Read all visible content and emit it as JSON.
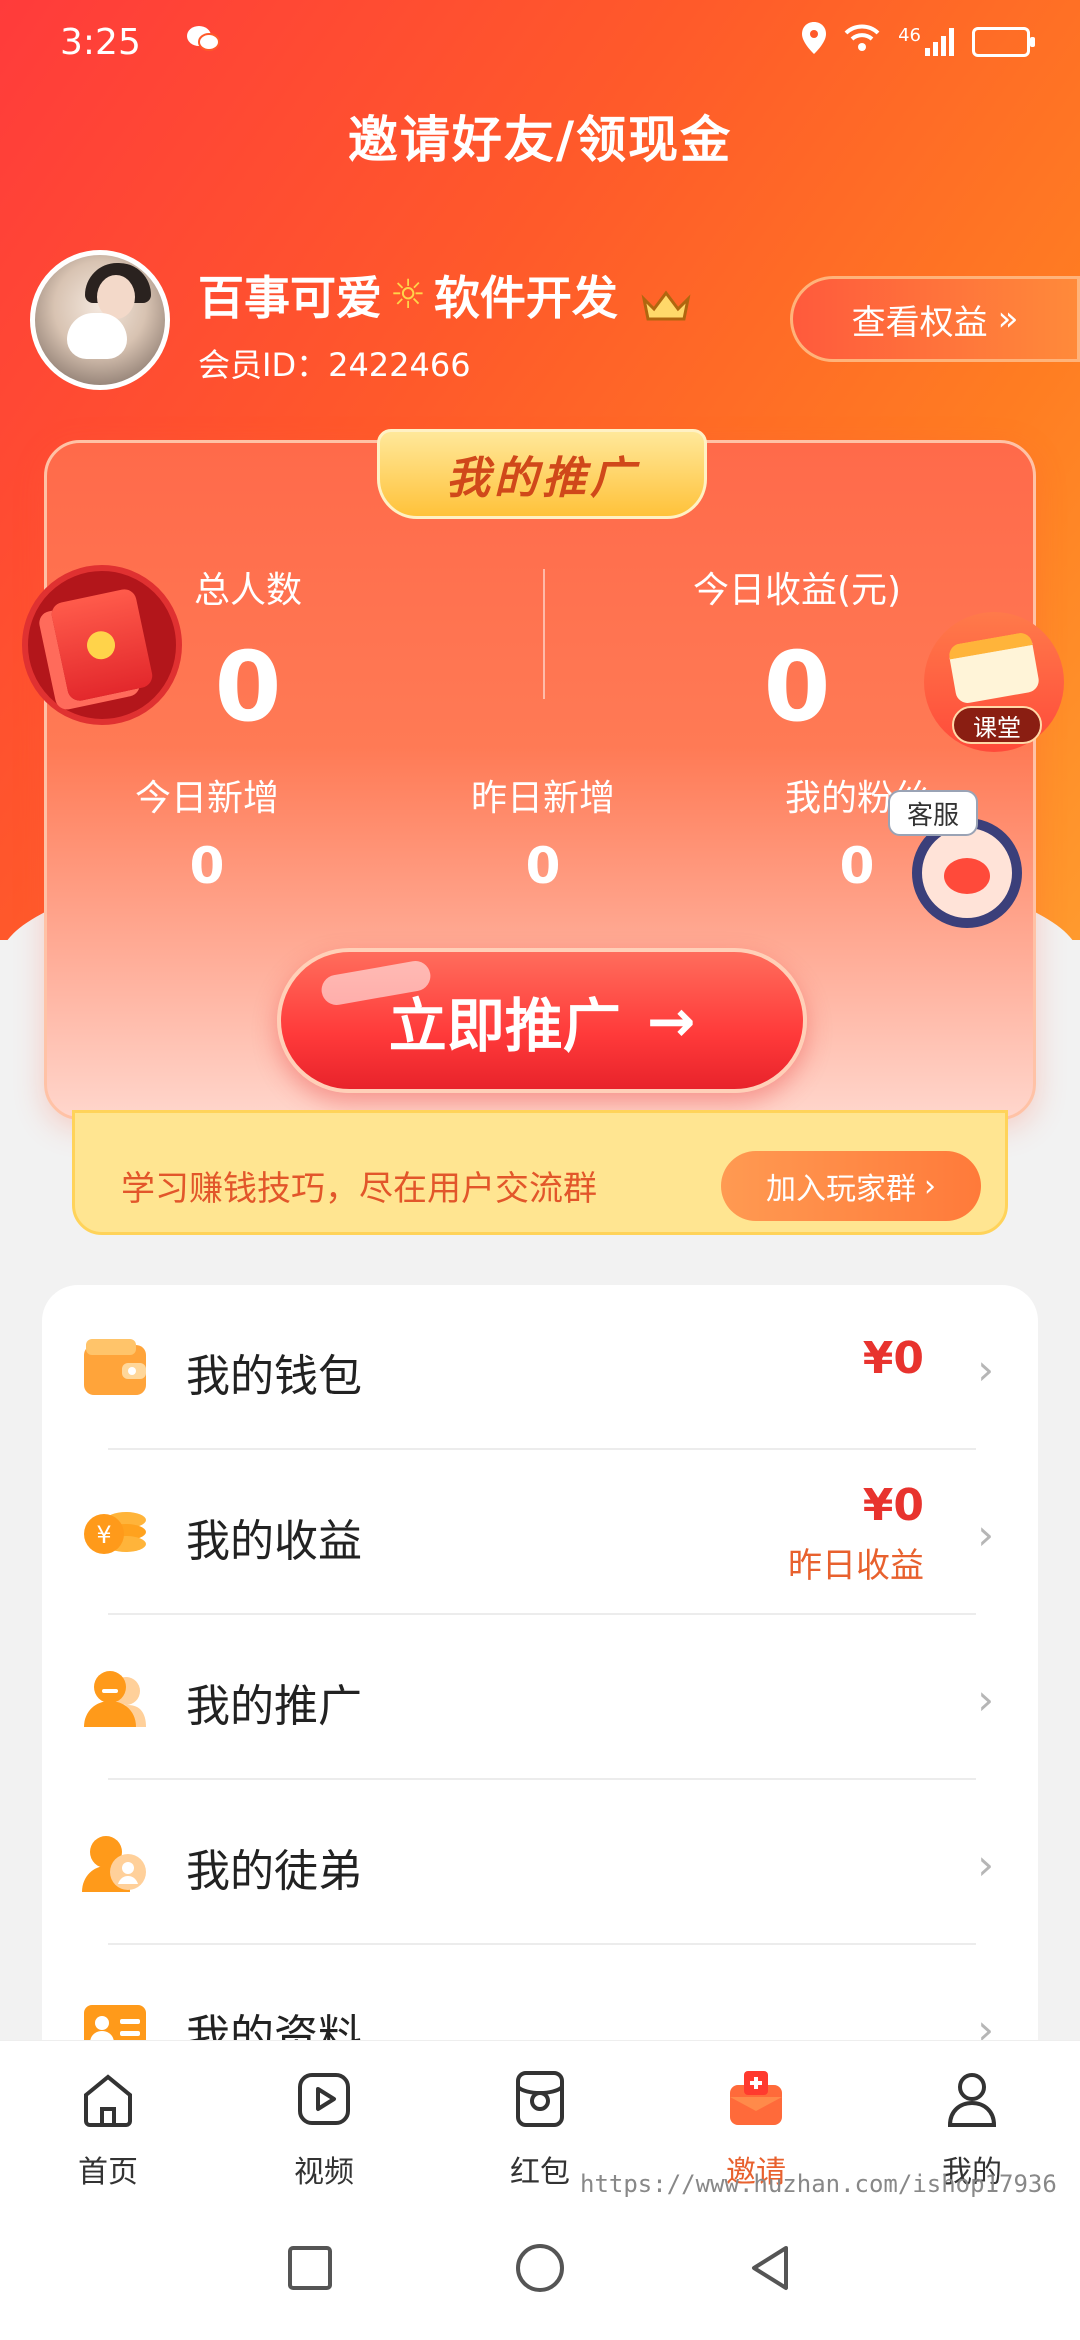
{
  "status_bar": {
    "time": "3:25",
    "network": "46"
  },
  "header": {
    "title": "邀请好友/领现金"
  },
  "profile": {
    "name_part1": "百事可爱",
    "name_part2": "软件开发",
    "member_id": "会员ID：2422466",
    "rights_button": "查看权益",
    "rights_chevron": "»"
  },
  "promotion": {
    "tag": "我的推广",
    "total_people_label": "总人数",
    "total_people_value": "0",
    "today_income_label": "今日收益(元)",
    "today_income_value": "0",
    "today_new_label": "今日新增",
    "today_new_value": "0",
    "yesterday_new_label": "昨日新增",
    "yesterday_new_value": "0",
    "fans_label": "我的粉丝",
    "fans_value": "0",
    "promote_button": "立即推广",
    "promote_arrow": "→"
  },
  "floating": {
    "course_label": "课堂",
    "service_label": "客服"
  },
  "banner": {
    "text": "学习赚钱技巧，尽在用户交流群",
    "join_button": "加入玩家群",
    "join_chevron": "›"
  },
  "menu": {
    "wallet": {
      "label": "我的钱包",
      "value": "¥0"
    },
    "earnings": {
      "label": "我的收益",
      "value": "¥0",
      "sub": "昨日收益"
    },
    "promotion": {
      "label": "我的推广"
    },
    "apprentice": {
      "label": "我的徒弟"
    },
    "profile": {
      "label": "我的资料"
    },
    "chevron": "›"
  },
  "tabbar": {
    "home": "首页",
    "video": "视频",
    "redpacket": "红包",
    "invite": "邀请",
    "mine": "我的"
  },
  "watermark": "https://www.huzhan.com/ishop17936",
  "colors": {
    "accent": "#ff5a2a",
    "price": "#e8332e",
    "active_tab": "#e8612e",
    "banner_bg": "#ffe591"
  }
}
